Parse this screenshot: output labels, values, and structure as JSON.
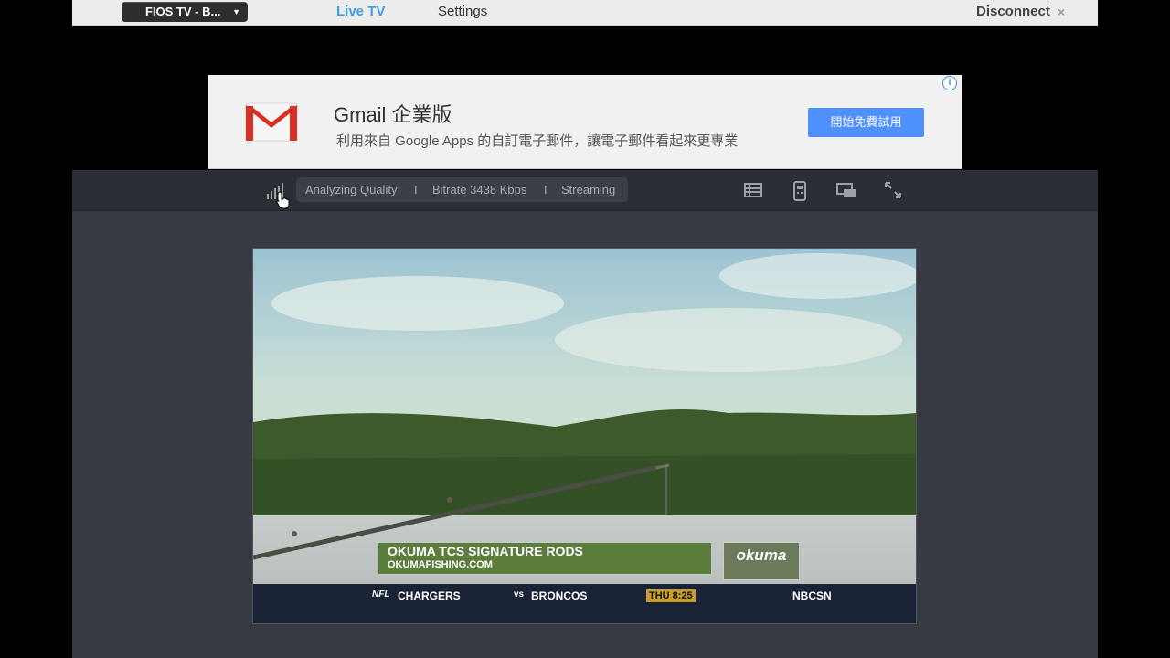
{
  "topbar": {
    "device_label": "FIOS TV - B...",
    "nav_live": "Live TV",
    "nav_settings": "Settings",
    "disconnect": "Disconnect",
    "disconnect_icon": "×"
  },
  "ad": {
    "title": "Gmail 企業版",
    "description": "利用來自 Google Apps 的自訂電子郵件，讓電子郵件看起來更專業",
    "button": "開始免費試用",
    "info_icon": "i"
  },
  "status": {
    "quality": "Analyzing Quality",
    "sep1": "I",
    "bitrate": "Bitrate 3438 Kbps",
    "sep2": "I",
    "state": "Streaming"
  },
  "video": {
    "lower_third_title": "OKUMA TCS SIGNATURE RODS",
    "lower_third_url": "OKUMAFISHING.COM",
    "sponsor_logo": "okuma",
    "ticker_league": "NFL",
    "ticker_team1": "CHARGERS",
    "ticker_vs": "vs",
    "ticker_team2": "BRONCOS",
    "ticker_time": "THU 8:25",
    "network": "NBCSN"
  },
  "colors": {
    "accent": "#3da0e6",
    "ad_button": "#4d90fe",
    "player_bg": "#373a42"
  }
}
